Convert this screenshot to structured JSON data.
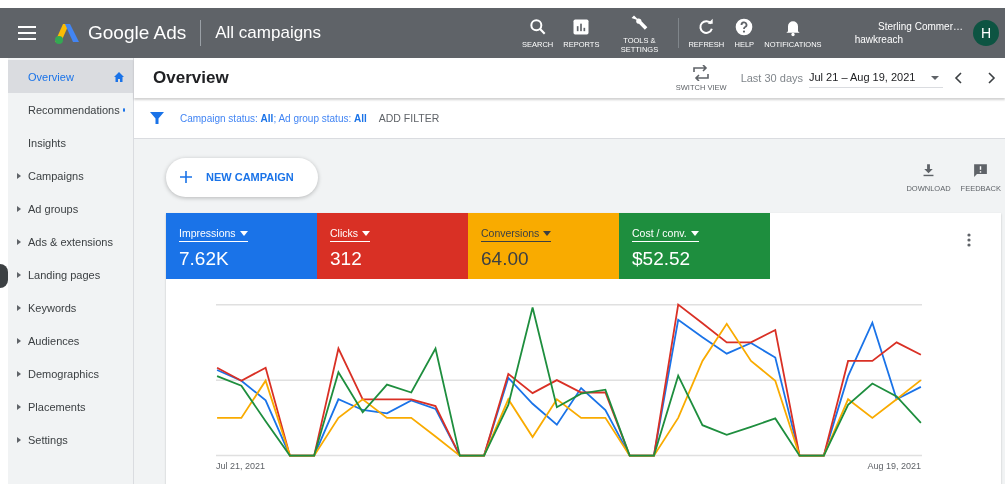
{
  "header": {
    "product": "Google Ads",
    "page_title": "All campaigns",
    "actions": [
      {
        "kind": "search",
        "label": "SEARCH"
      },
      {
        "kind": "reports",
        "label": "REPORTS"
      },
      {
        "kind": "tools",
        "label": "TOOLS & SETTINGS"
      },
      {
        "kind": "refresh",
        "label": "REFRESH"
      },
      {
        "kind": "help",
        "label": "HELP"
      },
      {
        "kind": "notifications",
        "label": "NOTIFICATIONS"
      }
    ],
    "account": {
      "name": "Sterling Commer…",
      "email": "hawkreach",
      "avatar": "H"
    }
  },
  "sidebar": {
    "items": [
      {
        "label": "Overview",
        "kind": "home",
        "selected": true
      },
      {
        "label": "Recommendations",
        "kind": "dot",
        "selected": false
      },
      {
        "label": "Insights",
        "kind": "plain",
        "selected": false
      },
      {
        "label": "Campaigns",
        "kind": "group",
        "selected": false
      },
      {
        "label": "Ad groups",
        "kind": "group",
        "selected": false
      },
      {
        "label": "Ads & extensions",
        "kind": "group",
        "selected": false
      },
      {
        "label": "Landing pages",
        "kind": "group",
        "selected": false
      },
      {
        "label": "Keywords",
        "kind": "group",
        "selected": false
      },
      {
        "label": "Audiences",
        "kind": "group",
        "selected": false
      },
      {
        "label": "Demographics",
        "kind": "group",
        "selected": false
      },
      {
        "label": "Placements",
        "kind": "group",
        "selected": false
      },
      {
        "label": "Settings",
        "kind": "group",
        "selected": false
      }
    ]
  },
  "title_bar": {
    "title": "Overview",
    "switch_view": "SWITCH VIEW",
    "date_label": "Last 30 days",
    "date_range": "Jul 21 – Aug 19, 2021"
  },
  "filter_bar": {
    "filter": "Campaign status: **All**; Ad group status: **All**",
    "add_filter": "ADD FILTER"
  },
  "toolbar": {
    "new_campaign": "NEW CAMPAIGN",
    "actions": [
      {
        "kind": "download",
        "label": "DOWNLOAD"
      },
      {
        "kind": "feedback",
        "label": "FEEDBACK"
      }
    ]
  },
  "metrics": [
    {
      "label": "Impressions",
      "value": "7.62K",
      "color": "#1a73e8"
    },
    {
      "label": "Clicks",
      "value": "312",
      "color": "#d93025"
    },
    {
      "label": "Conversions",
      "value": "64.00",
      "color": "#f9ab00"
    },
    {
      "label": "Cost / conv.",
      "value": "$52.52",
      "color": "#1e8e3e"
    }
  ],
  "chart": {
    "start_label": "Jul 21, 2021",
    "end_label": "Aug 19, 2021"
  }
}
